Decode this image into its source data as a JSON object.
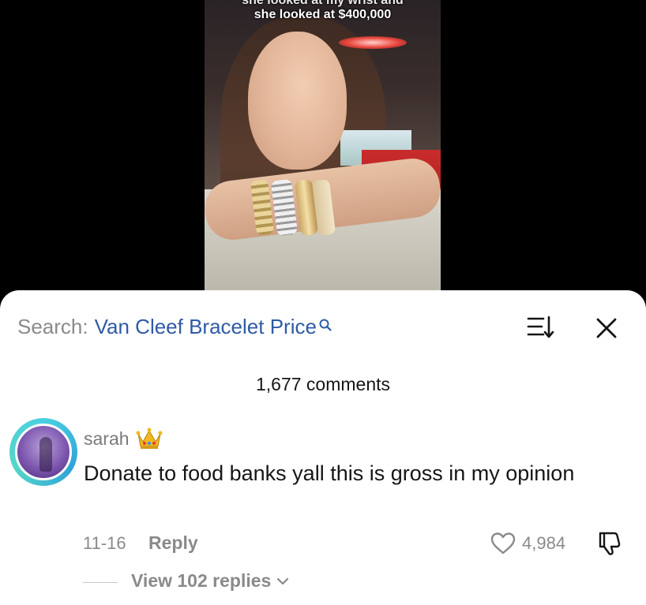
{
  "video": {
    "caption_line_1": "she looked at my wrist and",
    "caption_line_2": "she looked at $400,000"
  },
  "search": {
    "prefix": "Search:",
    "term": "Van Cleef Bracelet Price",
    "icon": "search-icon"
  },
  "header": {
    "comment_count": "1,677 comments",
    "sort_icon": "sort-icon",
    "close_icon": "close-icon"
  },
  "comment": {
    "username": "sarah",
    "badge_icon": "crown-icon",
    "text": "Donate to food banks yall this is gross in my opinion",
    "date": "11-16",
    "reply_label": "Reply",
    "like_count": "4,984",
    "view_replies_label": "View 102 replies"
  },
  "colors": {
    "search_term": "#2f5aa6",
    "muted_text": "#8a8a8a",
    "avatar_ring": "#4ad0e0"
  }
}
